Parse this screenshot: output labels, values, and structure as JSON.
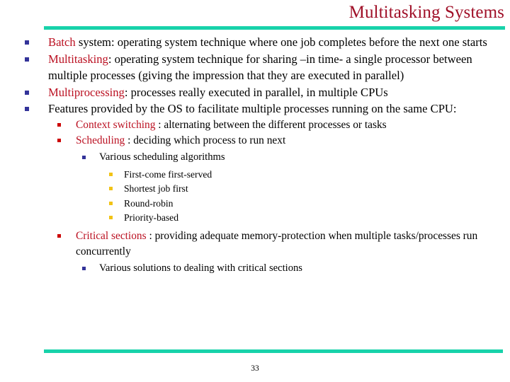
{
  "slide": {
    "title": "Multitasking Systems",
    "page_number": "33",
    "accent_color": "#18D2AA",
    "title_color": "#A01028",
    "highlight_color": "#BB1122",
    "bullet_colors": {
      "level1": "#333399",
      "level2": "#CC0000",
      "level3": "#333399",
      "level4": "#F2C316"
    }
  },
  "content": {
    "b1": {
      "term": "Batch",
      "rest": " system: operating system technique where one job completes before the next one starts"
    },
    "b2": {
      "term": "Multitasking",
      "rest": ": operating system technique for sharing –in time- a single processor between multiple processes (giving the impression that they are executed in parallel)"
    },
    "b3": {
      "term": "Multiprocessing",
      "rest": ": processes really executed in parallel, in multiple CPUs"
    },
    "b4": {
      "term": "",
      "rest": "Features provided by the OS to facilitate multiple processes running on the same CPU:"
    },
    "b4_1": {
      "term": "Context switching",
      "rest": " : alternating between the different processes or tasks"
    },
    "b4_2": {
      "term": "Scheduling",
      "rest": " : deciding which process to run next"
    },
    "b4_2_1": {
      "text": "Various scheduling algorithms"
    },
    "algorithms": [
      "First-come first-served",
      "Shortest job first",
      "Round-robin",
      "Priority-based"
    ],
    "b4_3": {
      "term": "Critical sections",
      "rest": " : providing adequate memory-protection when multiple tasks/processes run concurrently"
    },
    "b4_3_1": {
      "text": "Various solutions to dealing with critical sections"
    }
  }
}
